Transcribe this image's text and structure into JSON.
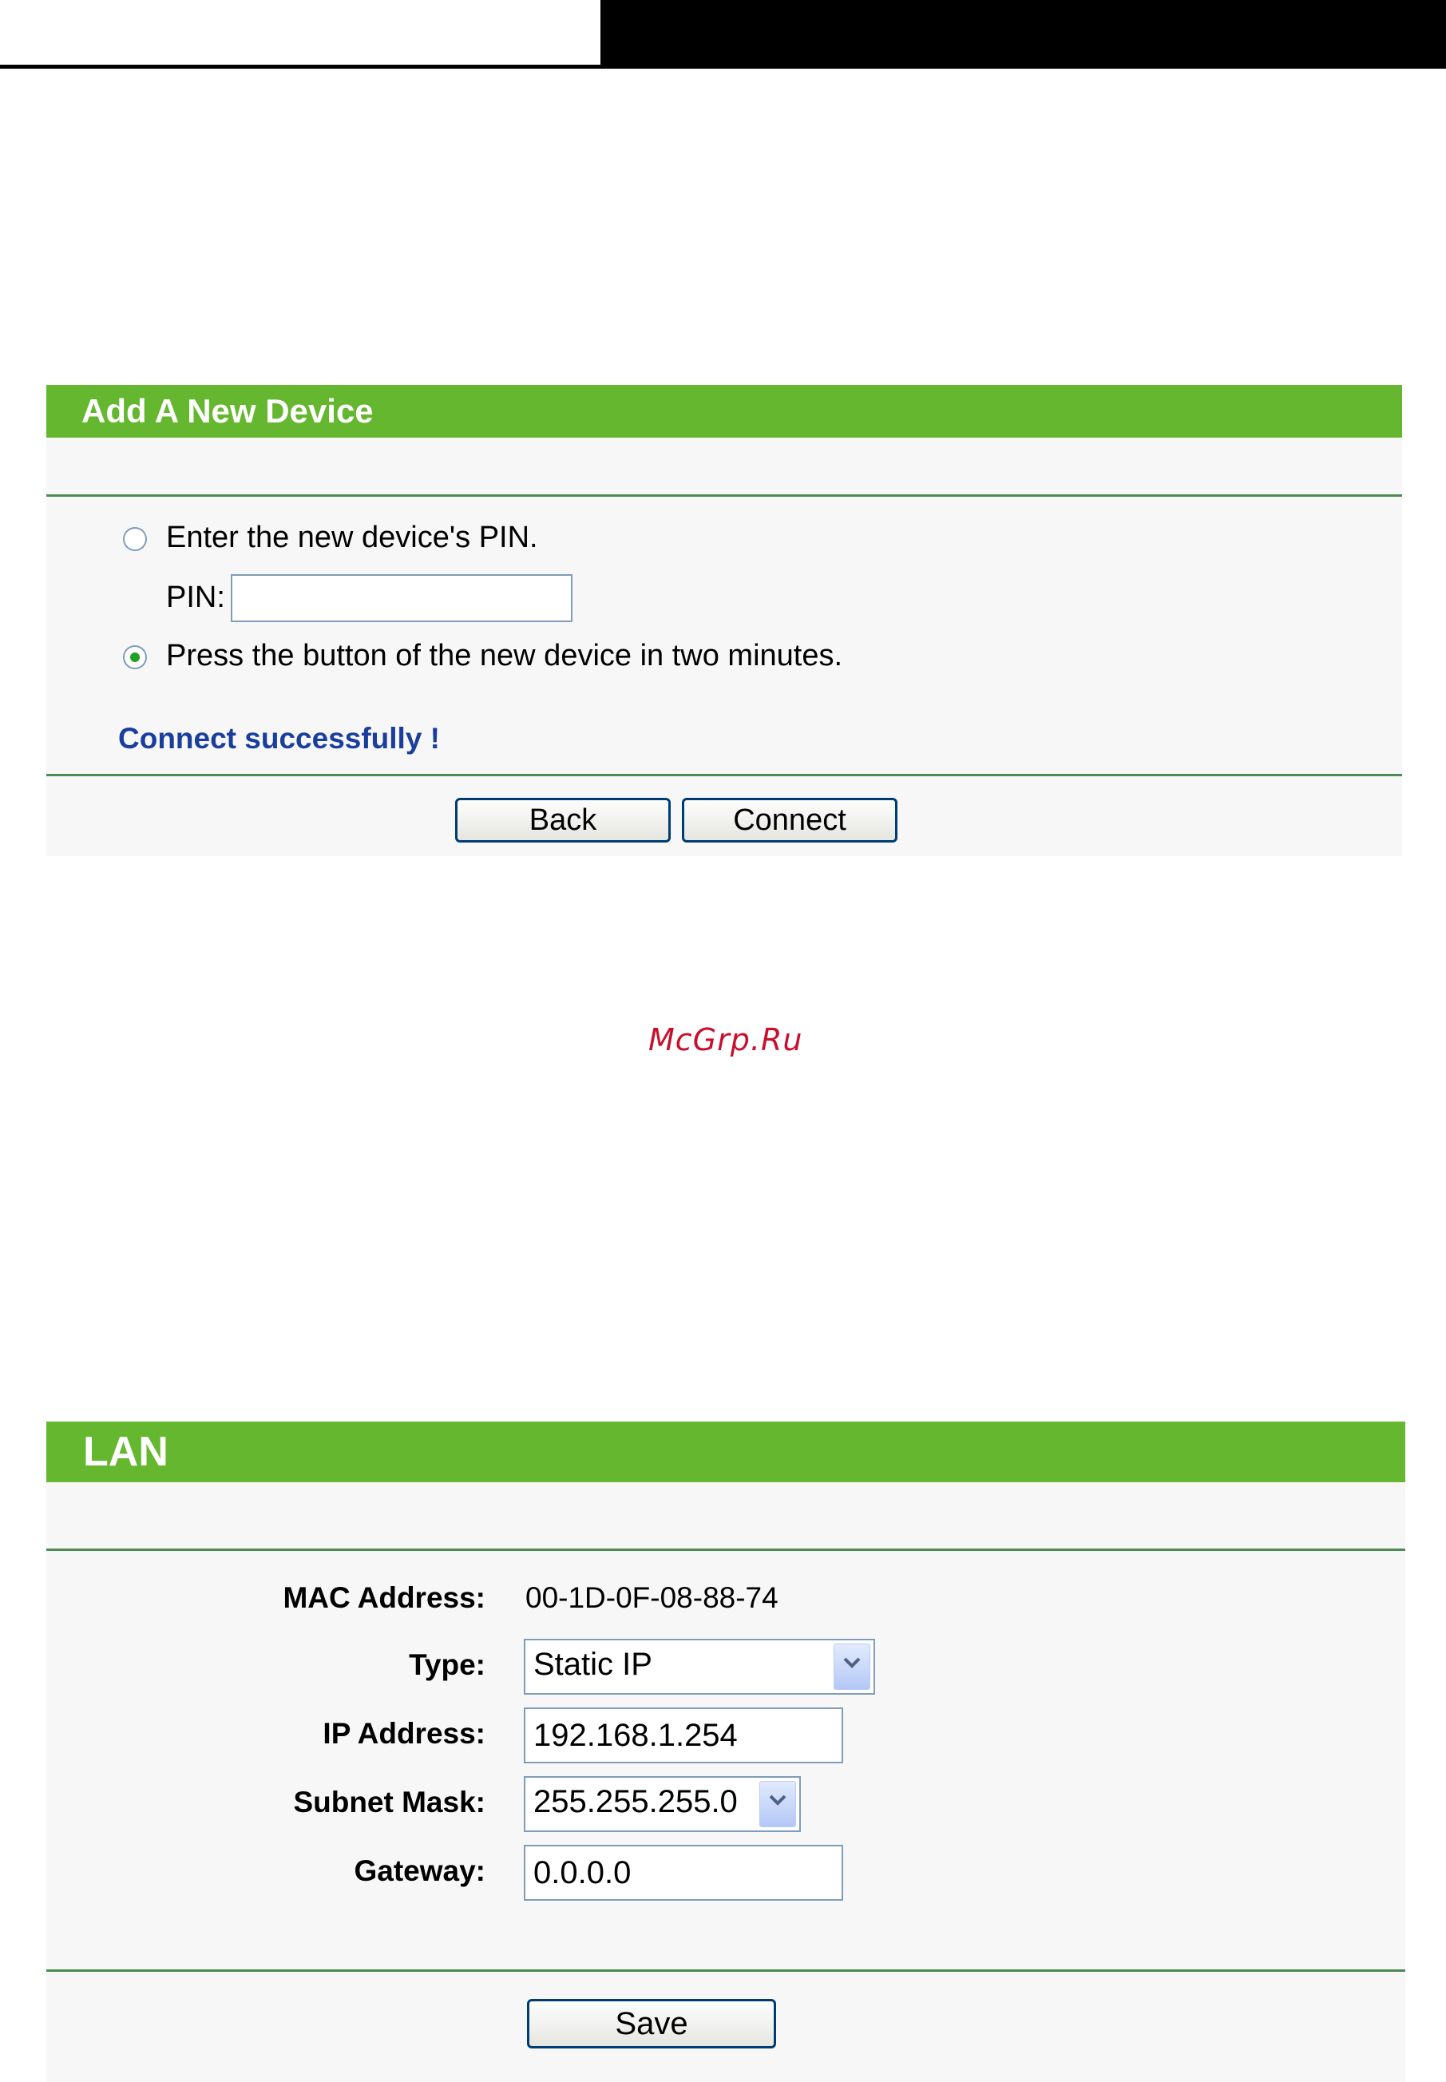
{
  "wps": {
    "title": "Add A New Device",
    "option_pin_label": "Enter the new device's PIN.",
    "pin_label": "PIN:",
    "pin_value": "",
    "option_button_label": "Press the button of the new device in two minutes.",
    "selected_option": "button",
    "status": "Connect successfully !",
    "back_label": "Back",
    "connect_label": "Connect",
    "status_color": "#1a3e9c"
  },
  "watermark": "McGrp.Ru",
  "lan": {
    "title": "LAN",
    "mac_label": "MAC Address:",
    "mac_value": "00-1D-0F-08-88-74",
    "type_label": "Type:",
    "type_value": "Static IP",
    "ip_label": "IP Address:",
    "ip_value": "192.168.1.254",
    "mask_label": "Subnet Mask:",
    "mask_value": "255.255.255.0",
    "gateway_label": "Gateway:",
    "gateway_value": "0.0.0.0",
    "save_label": "Save"
  },
  "colors": {
    "header_green": "#64b72e",
    "rule_green": "#4d8a54",
    "button_border": "#003c74"
  }
}
